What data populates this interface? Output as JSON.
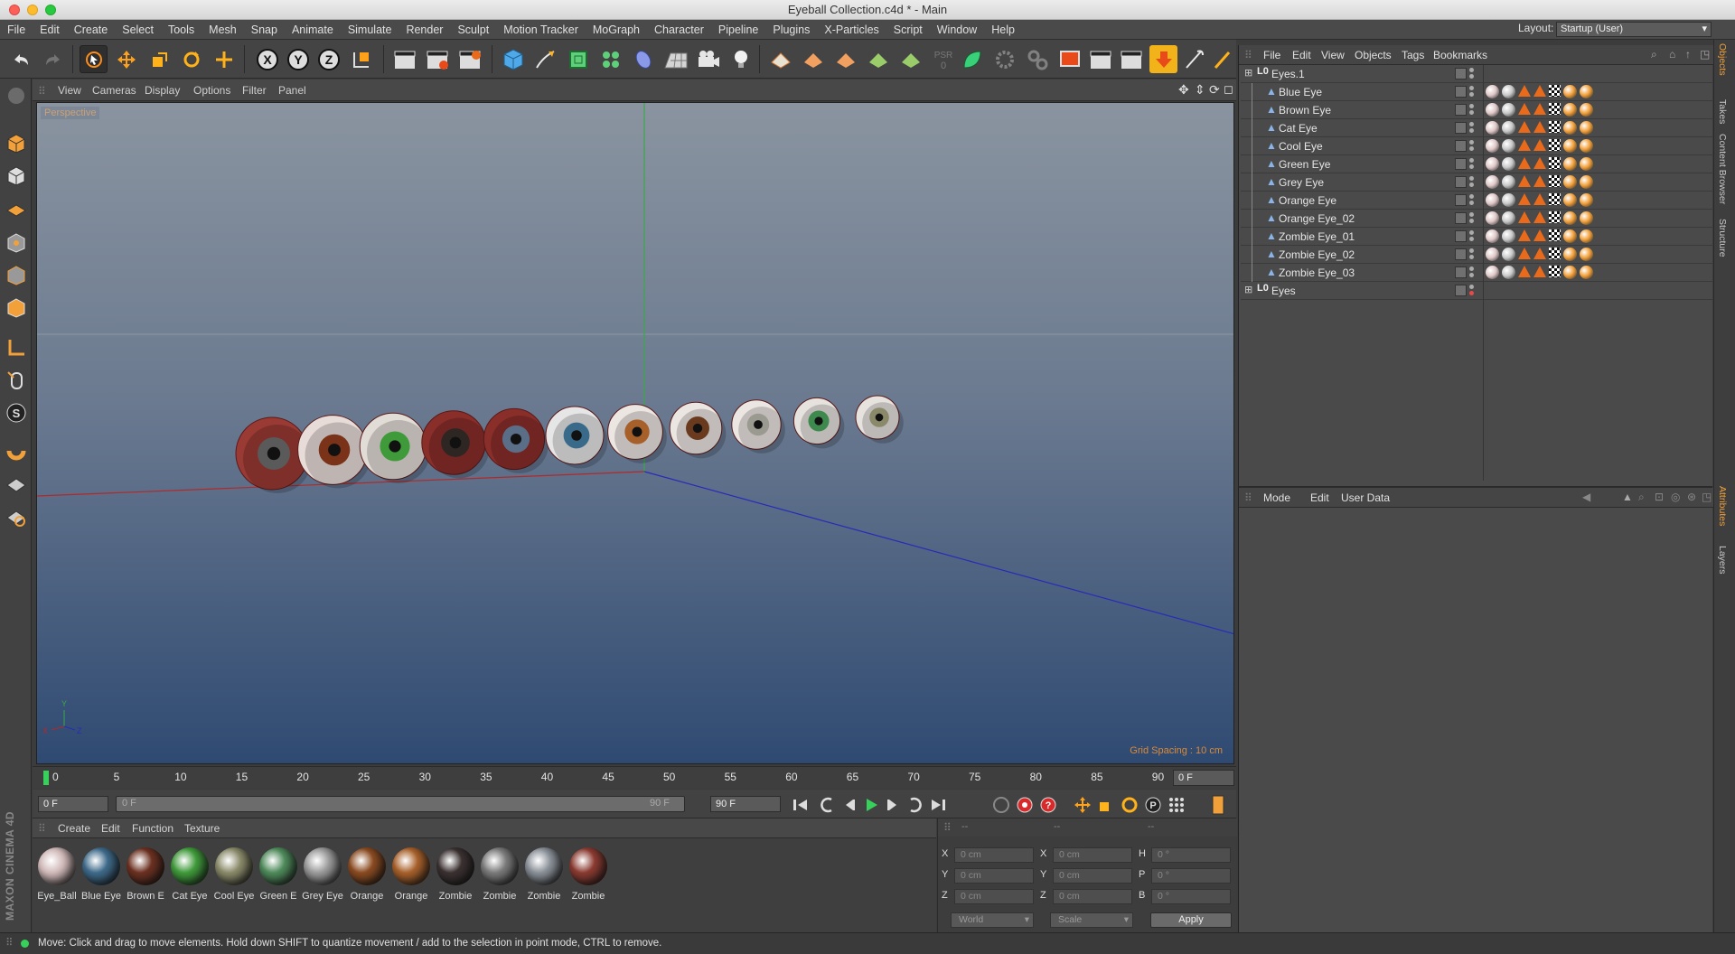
{
  "window": {
    "title": "Eyeball Collection.c4d * - Main"
  },
  "menu": [
    "File",
    "Edit",
    "Create",
    "Select",
    "Tools",
    "Mesh",
    "Snap",
    "Animate",
    "Simulate",
    "Render",
    "Sculpt",
    "Motion Tracker",
    "MoGraph",
    "Character",
    "Pipeline",
    "Plugins",
    "X-Particles",
    "Script",
    "Window",
    "Help"
  ],
  "layout": {
    "label": "Layout:",
    "value": "Startup (User)"
  },
  "viewport": {
    "menu": [
      "View",
      "Cameras",
      "Display",
      "Options",
      "Filter",
      "Panel"
    ],
    "label": "Perspective",
    "grid_spacing": "Grid Spacing : 10 cm",
    "axis_y": "Y",
    "axis_x": "X",
    "axis_z": "Z"
  },
  "timeline": {
    "ticks": [
      "0",
      "5",
      "10",
      "15",
      "20",
      "25",
      "30",
      "35",
      "40",
      "45",
      "50",
      "55",
      "60",
      "65",
      "70",
      "75",
      "80",
      "85",
      "90"
    ],
    "current": "0 F",
    "start": "0 F",
    "range_start": "0 F",
    "range_end": "90 F",
    "end": "90 F"
  },
  "materials": {
    "menu": [
      "Create",
      "Edit",
      "Function",
      "Texture"
    ],
    "items": [
      {
        "label": "Eye_Ball",
        "color": "#d0b8b8"
      },
      {
        "label": "Blue Eye",
        "color": "#3e6a8a"
      },
      {
        "label": "Brown E",
        "color": "#6b3020"
      },
      {
        "label": "Cat Eye",
        "color": "#3f9a3a"
      },
      {
        "label": "Cool Eye",
        "color": "#8a8a6a"
      },
      {
        "label": "Green E",
        "color": "#4e8a5a"
      },
      {
        "label": "Grey Eye",
        "color": "#9a9a9a"
      },
      {
        "label": "Orange",
        "color": "#8a4a20"
      },
      {
        "label": "Orange",
        "color": "#a8602a"
      },
      {
        "label": "Zombie",
        "color": "#3a3030"
      },
      {
        "label": "Zombie",
        "color": "#7a7a7a"
      },
      {
        "label": "Zombie",
        "color": "#8a9098"
      },
      {
        "label": "Zombie",
        "color": "#8a3a30"
      }
    ]
  },
  "coords": {
    "headers": [
      "--",
      "--",
      "--"
    ],
    "rows": [
      {
        "a": "X",
        "av": "0 cm",
        "b": "X",
        "bv": "0 cm",
        "c": "H",
        "cv": "0 °"
      },
      {
        "a": "Y",
        "av": "0 cm",
        "b": "Y",
        "bv": "0 cm",
        "c": "P",
        "cv": "0 °"
      },
      {
        "a": "Z",
        "av": "0 cm",
        "b": "Z",
        "bv": "0 cm",
        "c": "B",
        "cv": "0 °"
      }
    ],
    "space": "World",
    "mode": "Scale",
    "apply": "Apply"
  },
  "objects": {
    "menu": [
      "File",
      "Edit",
      "View",
      "Objects",
      "Tags",
      "Bookmarks"
    ],
    "root": "Eyes.1",
    "children": [
      "Blue Eye",
      "Brown Eye",
      "Cat Eye",
      "Cool Eye",
      "Green Eye",
      "Grey Eye",
      "Orange Eye",
      "Orange Eye_02",
      "Zombie Eye_01",
      "Zombie Eye_02",
      "Zombie Eye_03"
    ],
    "root2": "Eyes"
  },
  "attributes": {
    "menu": [
      "Mode",
      "Edit",
      "User Data"
    ]
  },
  "side_tabs": [
    "Objects",
    "Takes",
    "Content Browser",
    "Structure",
    "Attributes",
    "Layers"
  ],
  "status": "Move: Click and drag to move elements. Hold down SHIFT to quantize movement / add to the selection in point mode, CTRL to remove.",
  "brand": "MAXON CINEMA 4D",
  "eyeballs": [
    {
      "iris": "#5a5a5a",
      "sclera": "#9a3a34"
    },
    {
      "iris": "#7a3218",
      "sclera": "#e8dcd8"
    },
    {
      "iris": "#3f9a3a",
      "sclera": "#e2dcd6"
    },
    {
      "iris": "#2e2622",
      "sclera": "#8a2e2a"
    },
    {
      "iris": "#5a6e88",
      "sclera": "#8a2e2a"
    },
    {
      "iris": "#3a6a8a",
      "sclera": "#e6e6e6"
    },
    {
      "iris": "#a8602a",
      "sclera": "#ece6e2"
    },
    {
      "iris": "#6a3a1e",
      "sclera": "#ece6e2"
    },
    {
      "iris": "#9a9a90",
      "sclera": "#ece6e2"
    },
    {
      "iris": "#3e8a4e",
      "sclera": "#e6e2de"
    },
    {
      "iris": "#8a8a6a",
      "sclera": "#e6e2de"
    }
  ]
}
